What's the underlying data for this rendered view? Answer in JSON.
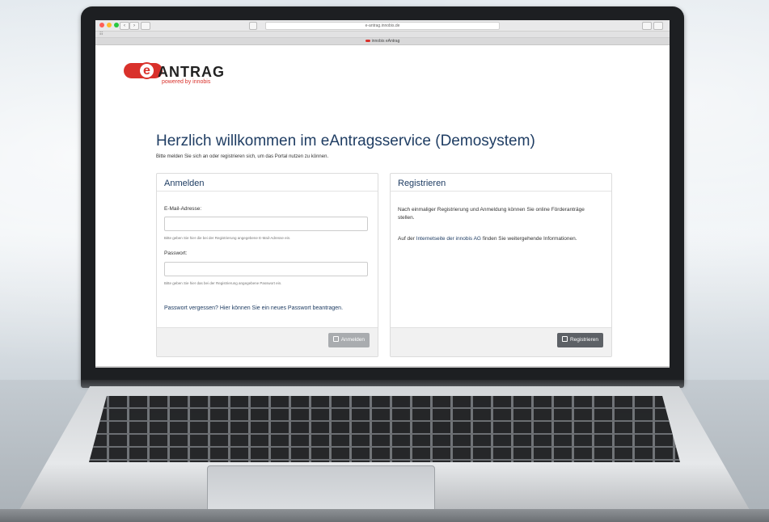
{
  "browser": {
    "url": "e-antrag.innobis.de",
    "tab_title": "innobis eAntrag",
    "traffic_lights": [
      "#ff5f57",
      "#febc2e",
      "#28c840"
    ],
    "back_label": "‹",
    "forward_label": "›"
  },
  "logo": {
    "wordmark": "ANTRAG",
    "letter": "e",
    "tagline": "powered by innobis",
    "brand_color": "#d9312b"
  },
  "page": {
    "title": "Herzlich willkommen im eAntragsservice (Demosystem)",
    "subtitle": "Bitte melden Sie sich an oder registrieren sich, um das Portal nutzen zu können."
  },
  "login": {
    "heading": "Anmelden",
    "email_label": "E-Mail-Adresse:",
    "email_value": "",
    "email_hint": "Bitte geben Sie hier die bei der Registrierung angegebene E-Mail-Adresse ein.",
    "password_label": "Passwort:",
    "password_value": "",
    "password_hint": "Bitte geben Sie hier das bei der Registrierung angegebene Passwort ein.",
    "forgot_link": "Passwort vergessen? Hier können Sie ein neues Passwort beantragen.",
    "submit_label": "Anmelden"
  },
  "register": {
    "heading": "Registrieren",
    "text1": "Nach einmaliger Registrierung und Anmeldung können Sie online Förderanträge stellen.",
    "text2_prefix": "Auf der ",
    "text2_link": "Internetseite der innobis AG",
    "text2_suffix": " finden Sie weitergehende Informationen.",
    "submit_label": "Registrieren"
  },
  "colors": {
    "heading": "#1f3d63",
    "button_disabled": "#a9acaf",
    "button_dark": "#5d6166"
  }
}
